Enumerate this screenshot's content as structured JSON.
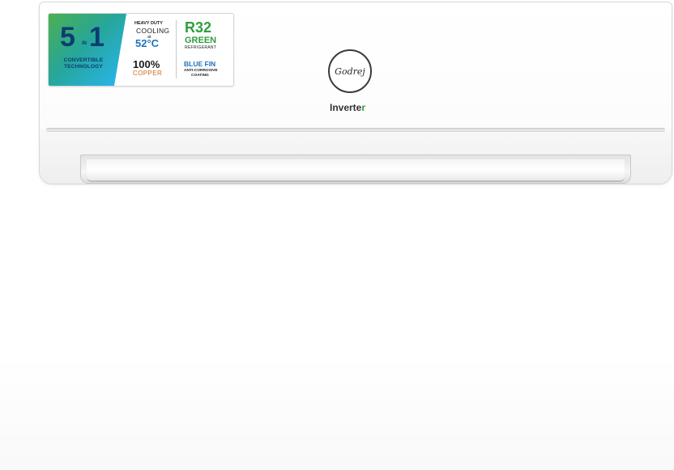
{
  "product": {
    "brand_logo_text": "Godrej",
    "mode_label": "Inverte",
    "mode_label_accent": "r"
  },
  "badge": {
    "convertible_digit_1": "5",
    "convertible_digit_2": "1",
    "convertible_in": "IN",
    "convertible_text": "CONVERTIBLE TECHNOLOGY",
    "heavy_duty": "HEAVY DUTY",
    "cooling": "COOLING",
    "at": "at",
    "temperature": "52°C",
    "copper_percent": "100%",
    "copper": "COPPER",
    "refrigerant_code": "R32",
    "refrigerant_type": "GREEN",
    "refrigerant_label": "REFRIGERANT",
    "fin": "BLUE FIN",
    "fin_detail": "ANTI-CORROSIVE",
    "fin_coating": "COATING"
  },
  "colors": {
    "badge_gradient_start": "#4caf50",
    "badge_gradient_end": "#29b6f6",
    "navy_text": "#0d3c73",
    "green_text": "#2e9e3e",
    "blue_text": "#1e73be",
    "copper_text": "#d2691e",
    "unit_body": "#fbfbfb"
  }
}
